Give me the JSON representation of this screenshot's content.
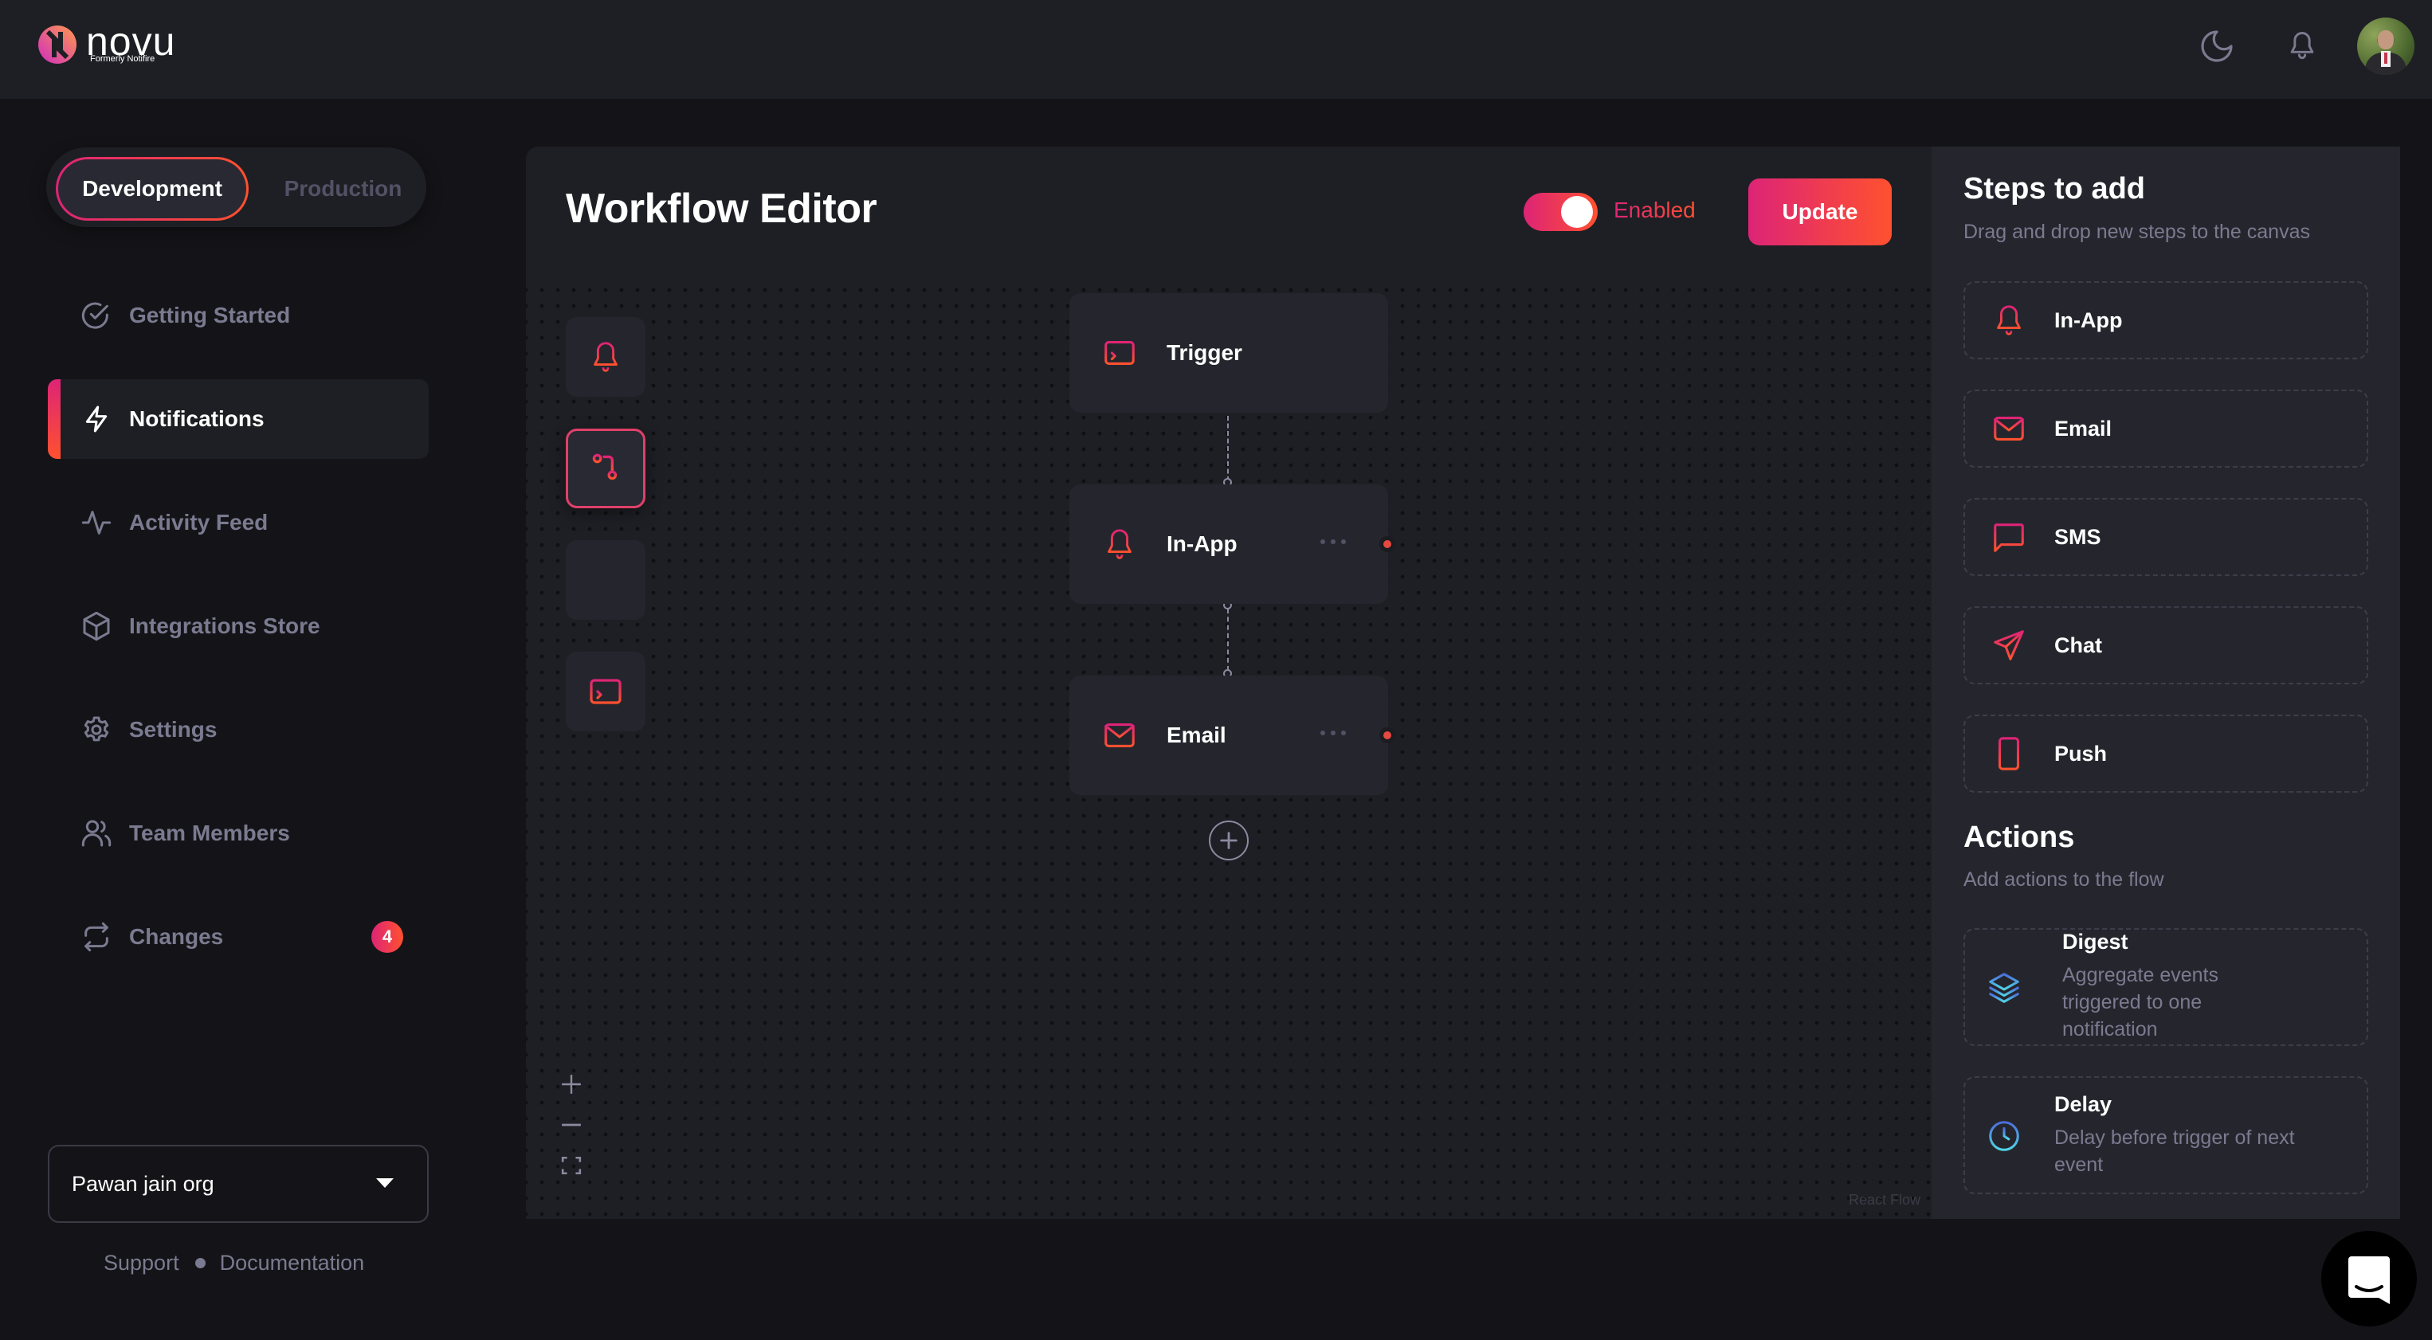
{
  "header": {
    "logo_text": "novu",
    "logo_subtitle": "Formerly Notifire",
    "icons": [
      "moon-icon",
      "bell-icon"
    ],
    "avatar_alt": "User avatar"
  },
  "sidebar": {
    "environments": [
      "Development",
      "Production"
    ],
    "active_environment": "Development",
    "items": [
      {
        "label": "Getting Started",
        "icon": "check-circle-icon",
        "active": false
      },
      {
        "label": "Notifications",
        "icon": "bolt-icon",
        "active": true
      },
      {
        "label": "Activity Feed",
        "icon": "activity-icon",
        "active": false
      },
      {
        "label": "Integrations Store",
        "icon": "box-icon",
        "active": false
      },
      {
        "label": "Settings",
        "icon": "gear-icon",
        "active": false
      },
      {
        "label": "Team Members",
        "icon": "users-icon",
        "active": false
      },
      {
        "label": "Changes",
        "icon": "repeat-icon",
        "active": false,
        "badge": "4"
      }
    ],
    "organization": "Pawan jain org",
    "footer_links": [
      "Support",
      "Documentation"
    ]
  },
  "editor": {
    "title": "Workflow Editor",
    "status_toggle": {
      "on": true,
      "label": "Enabled"
    },
    "update_label": "Update",
    "tools": [
      "bell-icon",
      "git-branch-icon",
      "sliders-icon",
      "terminal-window-icon"
    ],
    "selected_tool": "git-branch-icon",
    "nodes": [
      {
        "label": "Trigger",
        "icon": "terminal-window-icon"
      },
      {
        "label": "In-App",
        "icon": "bell-icon"
      },
      {
        "label": "Email",
        "icon": "mail-icon"
      }
    ],
    "zoom_controls": [
      "zoom-in",
      "zoom-out",
      "fit-view"
    ],
    "attribution": "React Flow"
  },
  "steps_panel": {
    "title": "Steps to add",
    "subtitle": "Drag and drop new steps to the canvas",
    "steps": [
      {
        "label": "In-App",
        "icon": "bell-icon"
      },
      {
        "label": "Email",
        "icon": "mail-icon"
      },
      {
        "label": "SMS",
        "icon": "message-square-icon"
      },
      {
        "label": "Chat",
        "icon": "send-icon"
      },
      {
        "label": "Push",
        "icon": "smartphone-icon"
      }
    ],
    "actions_title": "Actions",
    "actions_subtitle": "Add actions to the flow",
    "actions": [
      {
        "title": "Digest",
        "description": "Aggregate events triggered to one notification",
        "icon": "layers-icon"
      },
      {
        "title": "Delay",
        "description": "Delay before trigger of next event",
        "icon": "clock-icon"
      }
    ]
  },
  "colors": {
    "accent_start": "#dd2476",
    "accent_end": "#ff512f",
    "action_icon_start": "#4c6edb",
    "action_icon_end": "#50d5e8",
    "background": "#141418",
    "surface": "#1e1f24",
    "card": "#25262d",
    "muted_text": "#7a7a90"
  }
}
